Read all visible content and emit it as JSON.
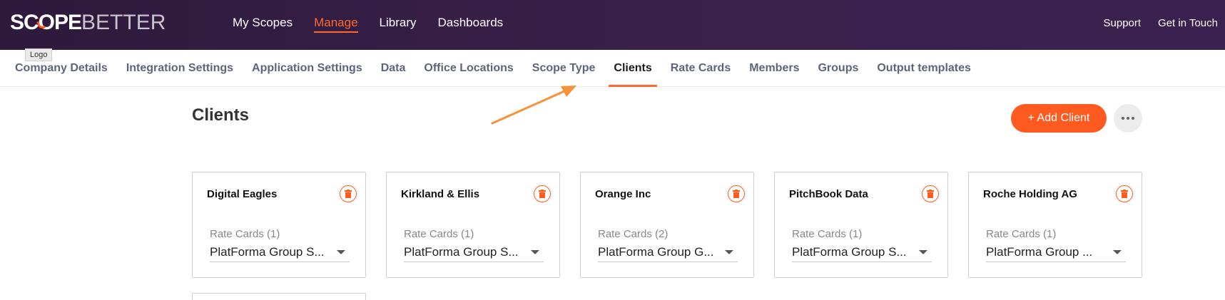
{
  "brand": {
    "part1": "SCOPE",
    "part2": "BETTER"
  },
  "tooltip": "Logo",
  "nav_main": [
    {
      "label": "My Scopes",
      "active": false
    },
    {
      "label": "Manage",
      "active": true
    },
    {
      "label": "Library",
      "active": false
    },
    {
      "label": "Dashboards",
      "active": false
    }
  ],
  "nav_right": [
    {
      "label": "Support"
    },
    {
      "label": "Get in Touch"
    }
  ],
  "subnav": [
    {
      "label": "Company Details",
      "active": false
    },
    {
      "label": "Integration Settings",
      "active": false
    },
    {
      "label": "Application Settings",
      "active": false
    },
    {
      "label": "Data",
      "active": false
    },
    {
      "label": "Office Locations",
      "active": false
    },
    {
      "label": "Scope Type",
      "active": false
    },
    {
      "label": "Clients",
      "active": true
    },
    {
      "label": "Rate Cards",
      "active": false
    },
    {
      "label": "Members",
      "active": false
    },
    {
      "label": "Groups",
      "active": false
    },
    {
      "label": "Output templates",
      "active": false
    }
  ],
  "page": {
    "title": "Clients",
    "add_label": "+ Add Client"
  },
  "clients": [
    {
      "name": "Digital Eagles",
      "rate_cards_label": "Rate Cards (1)",
      "rate_card": "PlatForma Group S..."
    },
    {
      "name": "Kirkland & Ellis",
      "rate_cards_label": "Rate Cards (1)",
      "rate_card": "PlatForma Group S..."
    },
    {
      "name": "Orange Inc",
      "rate_cards_label": "Rate Cards (2)",
      "rate_card": "PlatForma Group G..."
    },
    {
      "name": "PitchBook Data",
      "rate_cards_label": "Rate Cards (1)",
      "rate_card": "PlatForma Group S..."
    },
    {
      "name": "Roche Holding AG",
      "rate_cards_label": "Rate Cards (1)",
      "rate_card": "PlatForma Group ..."
    }
  ],
  "colors": {
    "accent": "#ff5a1f",
    "header": "#3a2049"
  },
  "icons": {
    "delete": "trash-icon",
    "more": "more-horizontal-icon",
    "dropdown": "caret-down-icon"
  }
}
